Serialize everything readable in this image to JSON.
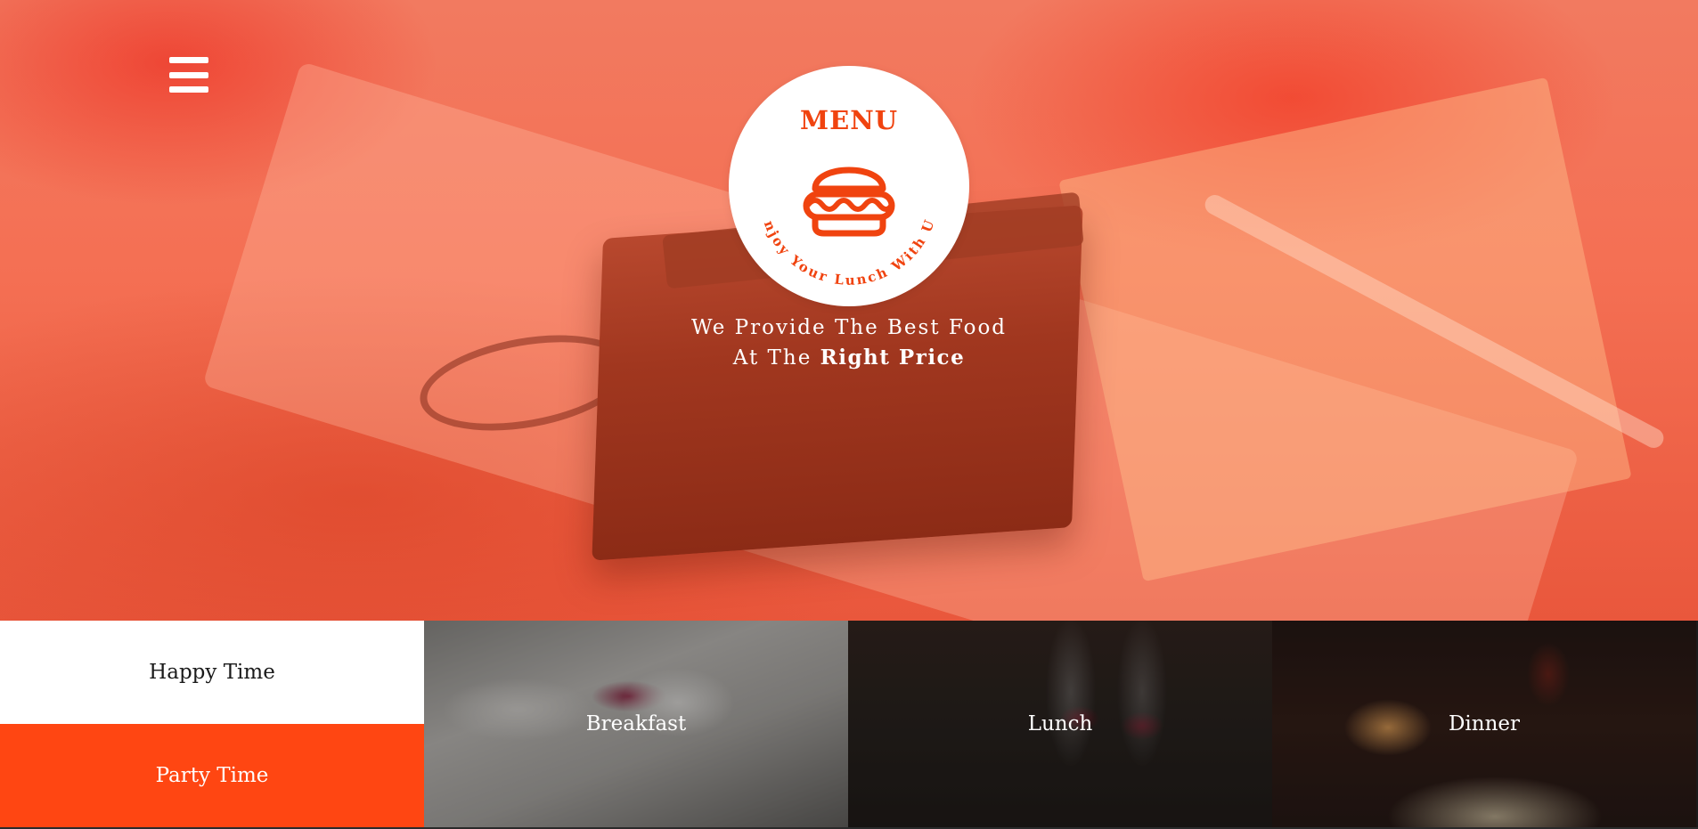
{
  "nav": {
    "menu_icon": "hamburger-icon"
  },
  "logo": {
    "title": "MENU",
    "icon": "burger-icon",
    "arc_text": "Enjoy Your Lunch With Us"
  },
  "hero": {
    "tagline_line1": "We Provide The Best Food",
    "tagline_line2_prefix": "At The ",
    "tagline_line2_bold": "Right Price"
  },
  "tiles": {
    "happy": "Happy Time",
    "party": "Party Time",
    "breakfast": "Breakfast",
    "lunch": "Lunch",
    "dinner": "Dinner"
  },
  "colors": {
    "accent": "#ff4612",
    "logo_orange": "#f0430f",
    "hero_overlay": "#f27a60"
  }
}
